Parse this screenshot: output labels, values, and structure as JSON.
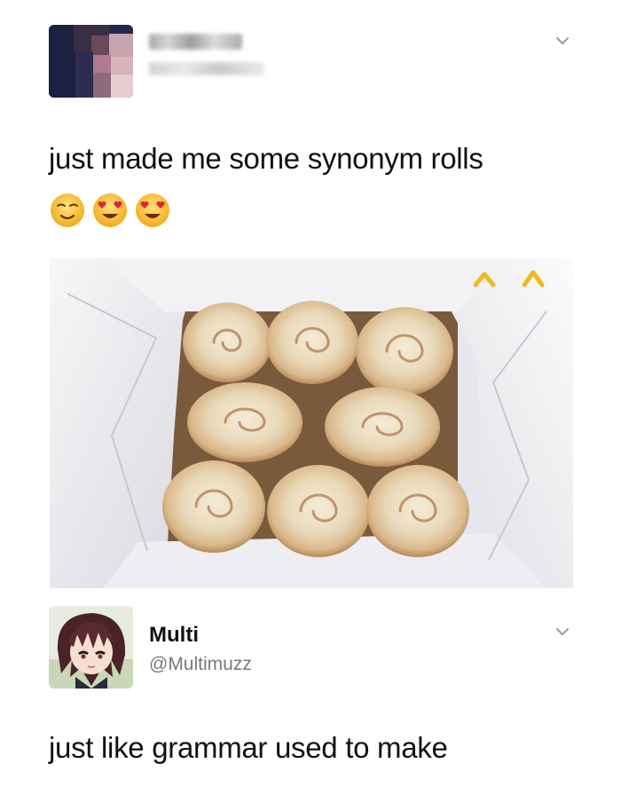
{
  "tweet": {
    "text": "just made me some synonym rolls",
    "emojis": [
      "relieved-face",
      "heart-eyes-face",
      "heart-eyes-face"
    ]
  },
  "photo": {
    "subject": "cinnamon-rolls-in-baking-pan-icon"
  },
  "reply": {
    "name": "Multi",
    "handle": "@Multimuzz",
    "text": "just like grammar used to make"
  },
  "colors": {
    "background": "#ffffff",
    "text": "#111111",
    "handle": "#7a7a7a",
    "chevron": "#9a9a9a"
  }
}
